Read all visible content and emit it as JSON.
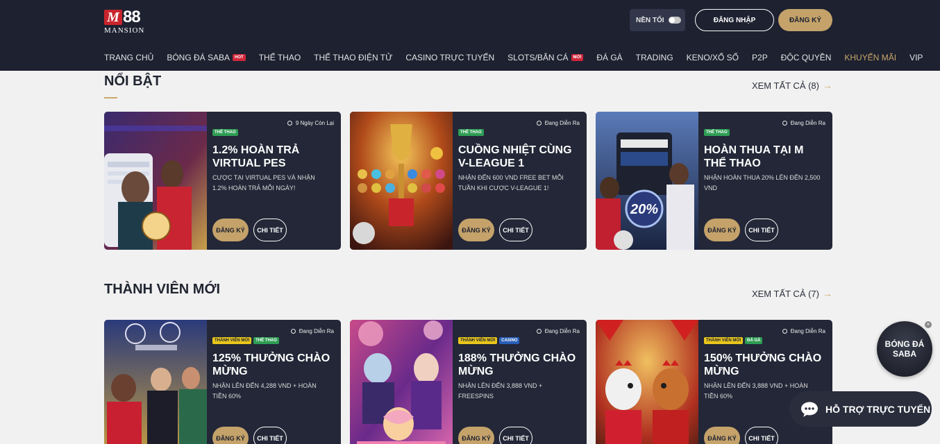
{
  "header": {
    "logo_top": "88",
    "logo_m": "M",
    "logo_sub": "MANSION",
    "dark_mode_label": "NỀN TỐI",
    "login_label": "ĐĂNG NHẬP",
    "register_label": "ĐĂNG KÝ"
  },
  "nav": [
    {
      "label": "TRANG CHỦ"
    },
    {
      "label": "BÓNG ĐÁ SABA",
      "badge": "HOT"
    },
    {
      "label": "THỂ THAO"
    },
    {
      "label": "THỂ THAO ĐIỆN TỬ"
    },
    {
      "label": "CASINO TRỰC TUYẾN"
    },
    {
      "label": "SLOTS/BẮN CÁ",
      "badge": "MỚI"
    },
    {
      "label": "ĐÁ GÀ"
    },
    {
      "label": "TRADING"
    },
    {
      "label": "KENO/XỔ SỐ"
    },
    {
      "label": "P2P"
    },
    {
      "label": "ĐỘC QUYỀN"
    },
    {
      "label": "KHUYẾN MÃI",
      "active": true
    },
    {
      "label": "VIP"
    }
  ],
  "sections": {
    "featured": {
      "title": "NỔI BẬT",
      "view_all": "XEM TẤT CẢ (8)",
      "cards": [
        {
          "status": "9 Ngày Còn Lại",
          "tags": [
            "THỂ THAO"
          ],
          "title": "1.2% HOÀN TRẢ VIRTUAL PES",
          "desc": "CƯỢC TẠI VIRTUAL PES VÀ NHẬN 1.2% HOÀN TRẢ MỖI NGÀY!",
          "register": "ĐĂNG KÝ",
          "detail": "CHI TIẾT"
        },
        {
          "status": "Đang Diễn Ra",
          "tags": [
            "THỂ THAO"
          ],
          "title": "CUỒNG NHIỆT CÙNG V-LEAGUE 1",
          "desc": "NHẬN ĐẾN 600 VND FREE BET MỖI TUẦN KHI CƯỢC V-LEAGUE 1!",
          "register": "ĐĂNG KÝ",
          "detail": "CHI TIẾT"
        },
        {
          "status": "Đang Diễn Ra",
          "tags": [
            "THỂ THAO"
          ],
          "title": "HOÀN THUA TẠI M THỂ THAO",
          "desc": "NHẬN HOÀN THUA 20% LÊN ĐẾN 2,500 VND",
          "img_text": "20%",
          "register": "ĐĂNG KÝ",
          "detail": "CHI TIẾT"
        }
      ]
    },
    "new_members": {
      "title": "THÀNH VIÊN MỚI",
      "view_all": "XEM TẤT CẢ (7)",
      "cards": [
        {
          "status": "Đang Diễn Ra",
          "tags": [
            "THÀNH VIÊN MỚI",
            "THỂ THAO"
          ],
          "title": "125% THƯỞNG CHÀO MỪNG",
          "desc": "NHẬN LÊN ĐẾN 4,288 VND + HOÀN TIỀN 60%",
          "register": "ĐĂNG KÝ",
          "detail": "CHI TIẾT"
        },
        {
          "status": "Đang Diễn Ra",
          "tags": [
            "THÀNH VIÊN MỚI",
            "CASINO"
          ],
          "title": "188% THƯỞNG CHÀO MỪNG",
          "desc": "NHẬN LÊN ĐẾN 3,888 VND + FREESPINS",
          "register": "ĐĂNG KÝ",
          "detail": "CHI TIẾT"
        },
        {
          "status": "Đang Diễn Ra",
          "tags": [
            "THÀNH VIÊN MỚI",
            "ĐÁ GÀ"
          ],
          "title": "150% THƯỞNG CHÀO MỪNG",
          "desc": "NHẬN LÊN ĐẾN 3,888 VND + HOÀN TIỀN 60%",
          "register": "ĐĂNG KÝ",
          "detail": "CHI TIẾT"
        }
      ]
    }
  },
  "floating": {
    "saba_line1": "BÓNG ĐÁ",
    "saba_line2": "SABA",
    "close": "×",
    "support_label": "HỖ TRỢ TRỰC TUYẾN"
  },
  "colors": {
    "header_bg": "#1d2130",
    "gold": "#c4a26a",
    "card_bg": "#232737",
    "hot_badge": "#d0263a"
  }
}
